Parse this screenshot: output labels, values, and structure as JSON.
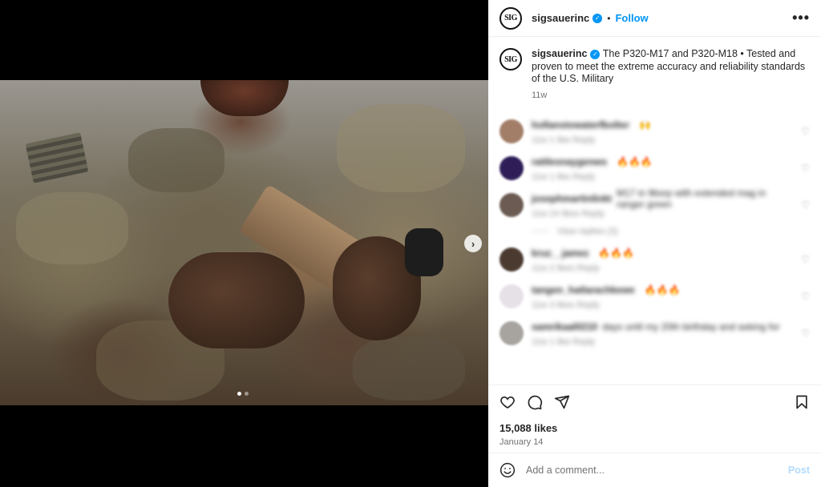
{
  "media": {
    "carousel_total": 2,
    "carousel_active": 1
  },
  "account": {
    "logo_text": "SIG",
    "username": "sigsauerinc",
    "verified_glyph": "✓",
    "follow_label": "Follow",
    "separator": "•",
    "more_label": "•••"
  },
  "caption": {
    "username": "sigsauerinc",
    "text": "The P320-M17 and P320-M18 • Tested and proven to meet the extreme accuracy and reliability standards of the U.S. Military",
    "age": "11w"
  },
  "comments": [
    {
      "user": "hollanstowaterfbolter",
      "text": "",
      "emoji": "🙌",
      "meta": "11w   1 like   Reply",
      "avatar_color": "#a27d68"
    },
    {
      "user": "rattlesnaygenws",
      "text": "",
      "emoji": "🔥🔥🔥",
      "meta": "11w   1 like   Reply",
      "avatar_color": "#2e1d57"
    },
    {
      "user": "josephmartinlinkt",
      "text": "M17 in 9bsrp with extended mag in ranger green",
      "emoji": "",
      "meta": "11w   24 likes   Reply",
      "avatar_color": "#6b5b52"
    },
    {
      "user": "kruz__jamez",
      "text": "",
      "emoji": "🔥🔥🔥",
      "meta": "11w   2 likes   Reply",
      "avatar_color": "#4a3a30"
    },
    {
      "user": "tangen_hatlarachkewe",
      "text": "",
      "emoji": "🔥🔥🔥",
      "meta": "11w   3 likes   Reply",
      "avatar_color": "#e6e1e6"
    },
    {
      "user": "samrikaal0210",
      "text": "days until my 20th birthday and asking for",
      "emoji": "",
      "meta": "11w   1 like   Reply",
      "avatar_color": "#a7a39e"
    }
  ],
  "replies_label": "View replies (3)",
  "like_icon": "♡",
  "icons": {
    "like": "heart-icon",
    "comment": "comment-icon",
    "share": "share-icon",
    "save": "bookmark-icon",
    "emoji": "emoji-icon",
    "next": "chevron-right-icon"
  },
  "next_glyph": "›",
  "stats": {
    "likes": "15,088 likes",
    "date": "January 14"
  },
  "composer": {
    "placeholder": "Add a comment...",
    "post_label": "Post"
  }
}
